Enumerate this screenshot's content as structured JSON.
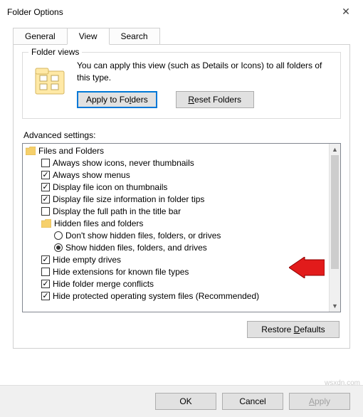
{
  "window": {
    "title": "Folder Options"
  },
  "tabs": {
    "general": "General",
    "view": "View",
    "search": "Search"
  },
  "folderViews": {
    "legend": "Folder views",
    "description": "You can apply this view (such as Details or Icons) to all folders of this type.",
    "applyBtn": "Apply to Folders",
    "applyAccel": "l",
    "resetBtn": "Reset Folders",
    "resetAccel": "R"
  },
  "advanced": {
    "label": "Advanced settings:",
    "root": "Files and Folders",
    "opts": [
      {
        "text": "Always show icons, never thumbnails",
        "checked": false
      },
      {
        "text": "Always show menus",
        "checked": true
      },
      {
        "text": "Display file icon on thumbnails",
        "checked": true
      },
      {
        "text": "Display file size information in folder tips",
        "checked": true
      },
      {
        "text": "Display the full path in the title bar",
        "checked": false
      }
    ],
    "hiddenGroup": "Hidden files and folders",
    "hiddenRadios": [
      {
        "text": "Don't show hidden files, folders, or drives",
        "checked": false
      },
      {
        "text": "Show hidden files, folders, and drives",
        "checked": true
      }
    ],
    "opts2": [
      {
        "text": "Hide empty drives",
        "checked": true
      },
      {
        "text": "Hide extensions for known file types",
        "checked": false
      },
      {
        "text": "Hide folder merge conflicts",
        "checked": true
      },
      {
        "text": "Hide protected operating system files (Recommended)",
        "checked": true
      }
    ],
    "restoreBtn": "Restore Defaults",
    "restoreAccel": "D"
  },
  "buttons": {
    "ok": "OK",
    "cancel": "Cancel",
    "apply": "Apply",
    "applyAccel": "A"
  },
  "watermark": "wsxdn.com"
}
